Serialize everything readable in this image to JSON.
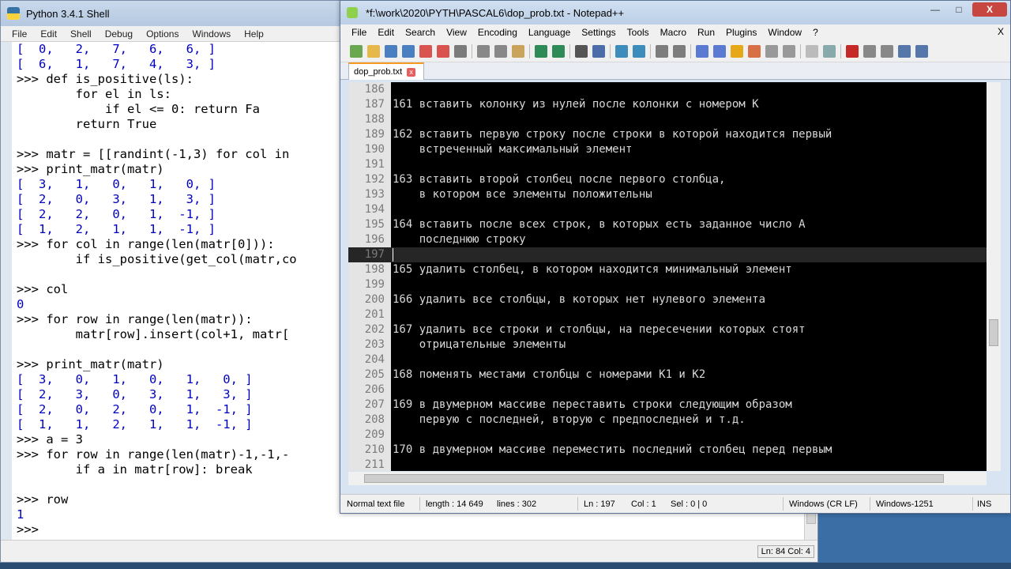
{
  "shell": {
    "title": "Python 3.4.1 Shell",
    "menu": [
      "File",
      "Edit",
      "Shell",
      "Debug",
      "Options",
      "Windows",
      "Help"
    ],
    "lines": [
      {
        "t": "[  0,   2,   7,   6,   6, ]",
        "k": "c-out"
      },
      {
        "t": "[  6,   1,   7,   4,   3, ]",
        "k": "c-out"
      },
      {
        "t": ">>> def is_positive(ls):",
        "k": "c-code"
      },
      {
        "t": "        for el in ls:",
        "k": "c-code"
      },
      {
        "t": "            if el <= 0: return Fa",
        "k": "c-code"
      },
      {
        "t": "        return True",
        "k": "c-code"
      },
      {
        "t": "",
        "k": "c-code"
      },
      {
        "t": ">>> matr = [[randint(-1,3) for col in",
        "k": "c-code"
      },
      {
        "t": ">>> print_matr(matr)",
        "k": "c-code"
      },
      {
        "t": "[  3,   1,   0,   1,   0, ]",
        "k": "c-out"
      },
      {
        "t": "[  2,   0,   3,   1,   3, ]",
        "k": "c-out"
      },
      {
        "t": "[  2,   2,   0,   1,  -1, ]",
        "k": "c-out"
      },
      {
        "t": "[  1,   2,   1,   1,  -1, ]",
        "k": "c-out"
      },
      {
        "t": ">>> for col in range(len(matr[0])):",
        "k": "c-code"
      },
      {
        "t": "        if is_positive(get_col(matr,co",
        "k": "c-code"
      },
      {
        "t": "",
        "k": "c-code"
      },
      {
        "t": ">>> col",
        "k": "c-code"
      },
      {
        "t": "0",
        "k": "c-out"
      },
      {
        "t": ">>> for row in range(len(matr)):",
        "k": "c-code"
      },
      {
        "t": "        matr[row].insert(col+1, matr[",
        "k": "c-code"
      },
      {
        "t": "",
        "k": "c-code"
      },
      {
        "t": ">>> print_matr(matr)",
        "k": "c-code"
      },
      {
        "t": "[  3,   0,   1,   0,   1,   0, ]",
        "k": "c-out"
      },
      {
        "t": "[  2,   3,   0,   3,   1,   3, ]",
        "k": "c-out"
      },
      {
        "t": "[  2,   0,   2,   0,   1,  -1, ]",
        "k": "c-out"
      },
      {
        "t": "[  1,   1,   2,   1,   1,  -1, ]",
        "k": "c-out"
      },
      {
        "t": ">>> a = 3",
        "k": "c-code"
      },
      {
        "t": ">>> for row in range(len(matr)-1,-1,-",
        "k": "c-code"
      },
      {
        "t": "        if a in matr[row]: break",
        "k": "c-code"
      },
      {
        "t": "",
        "k": "c-code"
      },
      {
        "t": ">>> row",
        "k": "c-code"
      },
      {
        "t": "1",
        "k": "c-out"
      },
      {
        "t": ">>> ",
        "k": "c-code"
      }
    ],
    "status_position": "Ln: 84  Col: 4"
  },
  "npp": {
    "title": "*f:\\work\\2020\\PYTH\\PASCAL6\\dop_prob.txt - Notepad++",
    "window_buttons": {
      "minimize": "—",
      "maximize": "□",
      "close": "X"
    },
    "menu": [
      "File",
      "Edit",
      "Search",
      "View",
      "Encoding",
      "Language",
      "Settings",
      "Tools",
      "Macro",
      "Run",
      "Plugins",
      "Window",
      "?"
    ],
    "menu_close": "X",
    "tab": {
      "label": "dop_prob.txt",
      "close": "x"
    },
    "lines": [
      {
        "n": "186",
        "t": ""
      },
      {
        "n": "187",
        "t": "161 вставить колонку из нулей после колонки с номером K"
      },
      {
        "n": "188",
        "t": ""
      },
      {
        "n": "189",
        "t": "162 вставить первую строку после строки в которой находится первый"
      },
      {
        "n": "190",
        "t": "    встреченный максимальный элемент"
      },
      {
        "n": "191",
        "t": ""
      },
      {
        "n": "192",
        "t": "163 вставить второй столбец после первого столбца,"
      },
      {
        "n": "193",
        "t": "    в котором все элементы положительны"
      },
      {
        "n": "194",
        "t": ""
      },
      {
        "n": "195",
        "t": "164 вставить после всех строк, в которых есть заданное число A"
      },
      {
        "n": "196",
        "t": "    последнюю строку"
      },
      {
        "n": "197",
        "t": "",
        "current": true
      },
      {
        "n": "198",
        "t": "165 удалить столбец, в котором находится минимальный элемент"
      },
      {
        "n": "199",
        "t": ""
      },
      {
        "n": "200",
        "t": "166 удалить все столбцы, в которых нет нулевого элемента"
      },
      {
        "n": "201",
        "t": ""
      },
      {
        "n": "202",
        "t": "167 удалить все строки и столбцы, на пересечении которых стоят"
      },
      {
        "n": "203",
        "t": "    отрицательные элементы"
      },
      {
        "n": "204",
        "t": ""
      },
      {
        "n": "205",
        "t": "168 поменять местами столбцы с номерами K1 и K2"
      },
      {
        "n": "206",
        "t": ""
      },
      {
        "n": "207",
        "t": "169 в двумерном массиве переставить строки следующим образом"
      },
      {
        "n": "208",
        "t": "    первую с последней, вторую с предпоследней и т.д."
      },
      {
        "n": "209",
        "t": ""
      },
      {
        "n": "210",
        "t": "170 в двумерном массиве переместить последний столбец перед первым"
      },
      {
        "n": "211",
        "t": ""
      }
    ],
    "status": {
      "file_type": "Normal text file",
      "length": "length : 14 649",
      "lines": "lines : 302",
      "ln": "Ln : 197",
      "col": "Col : 1",
      "sel": "Sel : 0 | 0",
      "eol": "Windows (CR LF)",
      "encoding": "Windows-1251",
      "mode": "INS"
    },
    "toolbar_icons": [
      "new-file-icon",
      "open-icon",
      "save-icon",
      "save-all-icon",
      "close-icon",
      "close-all-icon",
      "print-icon",
      "cut-icon",
      "copy-icon",
      "paste-icon",
      "undo-icon",
      "redo-icon",
      "find-icon",
      "replace-icon",
      "zoom-in-icon",
      "zoom-out-icon",
      "sync-v-icon",
      "sync-h-icon",
      "wrap-icon",
      "all-chars-icon",
      "indent-guide-icon",
      "udl-icon",
      "doc-map-icon",
      "function-list-icon",
      "folder-workspace-icon",
      "monitor-icon",
      "record-macro-icon",
      "stop-macro-icon",
      "play-macro-icon",
      "run-macro-multiple-icon",
      "save-macro-icon"
    ]
  }
}
